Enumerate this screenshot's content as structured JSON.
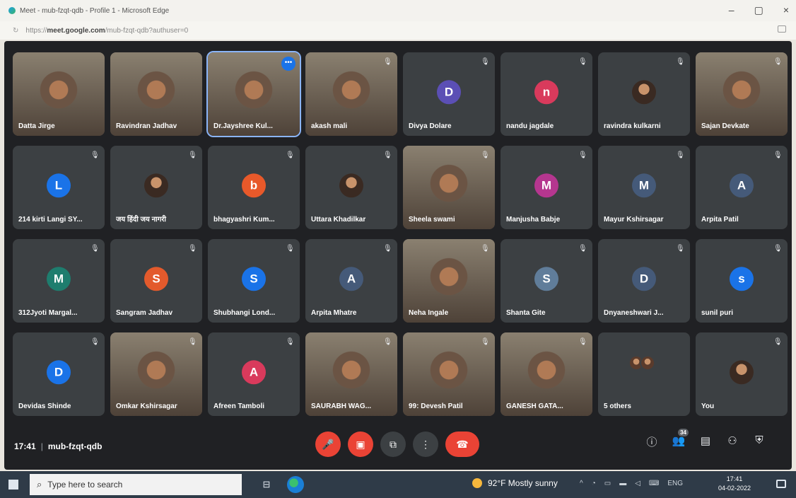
{
  "browser": {
    "title": "Meet - mub-fzqt-qdb - Profile 1 - Microsoft Edge",
    "url_prefix": "https://",
    "url_domain": "meet.google.com",
    "url_path": "/mub-fzqt-qdb?authuser=0",
    "minimize": "–",
    "maximize": "▢",
    "close": "×"
  },
  "participants": [
    {
      "name": "Datta Jirge",
      "kind": "video",
      "muted": false
    },
    {
      "name": "Ravindran Jadhav",
      "kind": "video",
      "muted": false
    },
    {
      "name": "Dr.Jayshree Kul...",
      "kind": "video",
      "muted": false,
      "active": true
    },
    {
      "name": "akash mali",
      "kind": "video",
      "muted": true
    },
    {
      "name": "Divya Dolare",
      "kind": "avatar",
      "initial": "D",
      "color": "#5b4fb5",
      "muted": true
    },
    {
      "name": "nandu jagdale",
      "kind": "avatar",
      "initial": "n",
      "color": "#d93a5c",
      "muted": true
    },
    {
      "name": "ravindra kulkarni",
      "kind": "photo",
      "muted": true
    },
    {
      "name": "Sajan Devkate",
      "kind": "video",
      "muted": true
    },
    {
      "name": "214 kirti Langi SY...",
      "kind": "avatar",
      "initial": "L",
      "color": "#1a73e8",
      "muted": true
    },
    {
      "name": "जय हिंदी जय नागरी",
      "kind": "photo",
      "muted": true
    },
    {
      "name": "bhagyashri Kum...",
      "kind": "avatar",
      "initial": "b",
      "color": "#e8592a",
      "muted": true
    },
    {
      "name": "Uttara Khadilkar",
      "kind": "photo",
      "muted": true
    },
    {
      "name": "Sheela swami",
      "kind": "video",
      "muted": true
    },
    {
      "name": "Manjusha Babje",
      "kind": "avatar",
      "initial": "M",
      "color": "#b5368f",
      "muted": true
    },
    {
      "name": "Mayur Kshirsagar",
      "kind": "avatar",
      "initial": "M",
      "color": "#455a79",
      "muted": true
    },
    {
      "name": "Arpita Patil",
      "kind": "avatar",
      "initial": "A",
      "color": "#455a79",
      "muted": true
    },
    {
      "name": "312Jyoti Margal...",
      "kind": "avatar",
      "initial": "M",
      "color": "#1e7d6e",
      "muted": true
    },
    {
      "name": "Sangram Jadhav",
      "kind": "avatar",
      "initial": "S",
      "color": "#e35a2c",
      "muted": true
    },
    {
      "name": "Shubhangi Lond...",
      "kind": "avatar",
      "initial": "S",
      "color": "#1a73e8",
      "muted": true
    },
    {
      "name": "Arpita Mhatre",
      "kind": "avatar",
      "initial": "A",
      "color": "#455a79",
      "muted": true
    },
    {
      "name": "Neha Ingale",
      "kind": "video",
      "muted": true
    },
    {
      "name": "Shanta Gite",
      "kind": "avatar",
      "initial": "S",
      "color": "#607d9a",
      "muted": true
    },
    {
      "name": "Dnyaneshwari J...",
      "kind": "avatar",
      "initial": "D",
      "color": "#455a79",
      "muted": true
    },
    {
      "name": "sunil puri",
      "kind": "avatar",
      "initial": "s",
      "color": "#1a73e8",
      "muted": true
    },
    {
      "name": "Devidas Shinde",
      "kind": "avatar",
      "initial": "D",
      "color": "#1a73e8",
      "muted": true
    },
    {
      "name": "Omkar Kshirsagar",
      "kind": "video",
      "muted": true
    },
    {
      "name": "Afreen Tamboli",
      "kind": "avatar",
      "initial": "A",
      "color": "#d93a5c",
      "muted": true
    },
    {
      "name": "SAURABH WAG...",
      "kind": "video",
      "muted": true
    },
    {
      "name": "99: Devesh Patil",
      "kind": "video",
      "muted": true
    },
    {
      "name": "GANESH GATA...",
      "kind": "video",
      "muted": true
    },
    {
      "name": "5 others",
      "kind": "others",
      "muted": false
    },
    {
      "name": "You",
      "kind": "photo",
      "muted": true
    }
  ],
  "meeting": {
    "time": "17:41",
    "separator": "|",
    "code": "mub-fzqt-qdb"
  },
  "controls": {
    "mic_icon": "🎤",
    "camera_icon": "▣",
    "present_icon": "⧉",
    "more_icon": "⋮",
    "end_icon": "☎",
    "info_icon": "ⓘ",
    "people_icon": "👥",
    "people_count": "34",
    "chat_icon": "▤",
    "activities_icon": "⚇",
    "security_icon": "⛨"
  },
  "taskbar": {
    "search_placeholder": "Type here to search",
    "weather": "92°F  Mostly sunny",
    "lang": "ENG",
    "clock_time": "17:41",
    "clock_date": "04-02-2022"
  }
}
